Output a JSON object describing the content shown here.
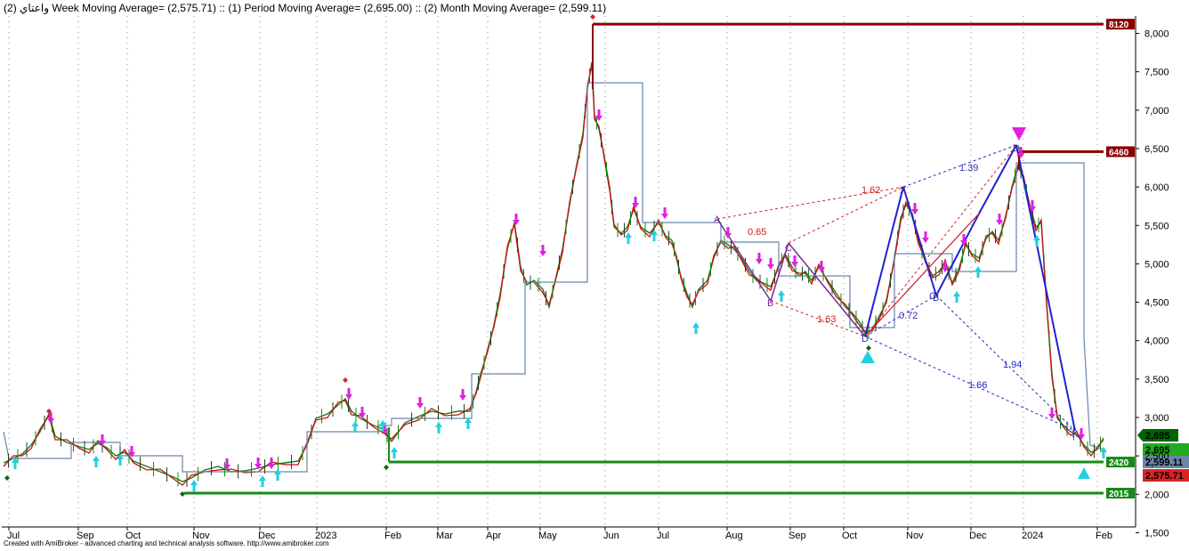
{
  "header": {
    "symbol": "واعتاي",
    "text": "(2) Week Moving Average= (2,575.71) :: (1) Period Moving Average= (2,695.00) :: (2) Month Moving Average= (2,599.11)"
  },
  "footer": {
    "text": "Created with AmiBroker - advanced charting and technical analysis software. http://www.amibroker.com"
  },
  "chart_data": {
    "type": "line",
    "ylim": [
      1500,
      8500
    ],
    "yticks": [
      "1,500",
      "2,000",
      "2,500",
      "3,000",
      "3,500",
      "4,000",
      "4,500",
      "5,000",
      "5,500",
      "6,000",
      "6,500",
      "7,000",
      "7,500",
      "8,000"
    ],
    "ytick_values": [
      1500,
      2000,
      2500,
      3000,
      3500,
      4000,
      4500,
      5000,
      5500,
      6000,
      6500,
      7000,
      7500,
      8000
    ],
    "xticks": [
      "Jul",
      "Sep",
      "Oct",
      "Nov",
      "Dec",
      "2023",
      "Feb",
      "Mar",
      "Apr",
      "May",
      "Jun",
      "Jul",
      "Aug",
      "Sep",
      "Oct",
      "Nov",
      "Dec",
      "2024",
      "Feb"
    ],
    "grid": true,
    "levels": [
      {
        "label": "8120",
        "value": 8120,
        "color": "#8b0000"
      },
      {
        "label": "6460",
        "value": 6460,
        "color": "#8b0000"
      },
      {
        "label": "2420",
        "value": 2420,
        "color": "#1a8a1a"
      },
      {
        "label": "2015",
        "value": 2015,
        "color": "#1a8a1a"
      }
    ],
    "value_labels": [
      {
        "label": "2,695",
        "value": 2695,
        "color": "#006400"
      },
      {
        "label": "2,695",
        "value": 2695,
        "color": "#22aa22"
      },
      {
        "label": "2,599.11",
        "value": 2599.11,
        "color": "#6a86a8"
      },
      {
        "label": "2,575.71",
        "value": 2575.71,
        "color": "#dd2222"
      }
    ],
    "pattern_points": [
      "A",
      "B",
      "C",
      "D",
      "X",
      "B",
      "C",
      "D",
      "X"
    ],
    "ratios": [
      {
        "label": "0.65",
        "color": "#cc2222"
      },
      {
        "label": "1.62",
        "color": "#cc2222"
      },
      {
        "label": "1.63",
        "color": "#cc2222"
      },
      {
        "label": "1.39",
        "color": "#3333aa"
      },
      {
        "label": "0.72",
        "color": "#3333aa"
      },
      {
        "label": "1.94",
        "color": "#2222cc"
      },
      {
        "label": "1.66",
        "color": "#2222cc"
      }
    ],
    "series": [
      {
        "name": "Price",
        "x": [
          "Jul",
          "Sep",
          "Oct",
          "Nov",
          "Dec",
          "2023",
          "Feb",
          "Mar",
          "Apr",
          "May",
          "Jun",
          "Jul",
          "Aug",
          "Sep",
          "Oct",
          "Nov",
          "Dec",
          "2024",
          "Feb"
        ],
        "values": [
          2300,
          2600,
          2450,
          2100,
          2200,
          2850,
          2700,
          2900,
          4600,
          4800,
          7650,
          5600,
          5100,
          4900,
          4050,
          5900,
          5100,
          6450,
          2695
        ]
      },
      {
        "name": "Week Moving Average",
        "values": [
          2300,
          2550,
          2420,
          2200,
          2230,
          2780,
          2650,
          2880,
          4300,
          4700,
          6800,
          5600,
          5150,
          4900,
          4100,
          5700,
          5000,
          6200,
          2575.71
        ]
      },
      {
        "name": "Month Moving Average",
        "values": [
          2400,
          2550,
          2400,
          2250,
          2250,
          2750,
          2750,
          2900,
          3500,
          4700,
          7350,
          5500,
          5400,
          4800,
          4800,
          5100,
          4850,
          6300,
          2599.11
        ]
      }
    ]
  }
}
